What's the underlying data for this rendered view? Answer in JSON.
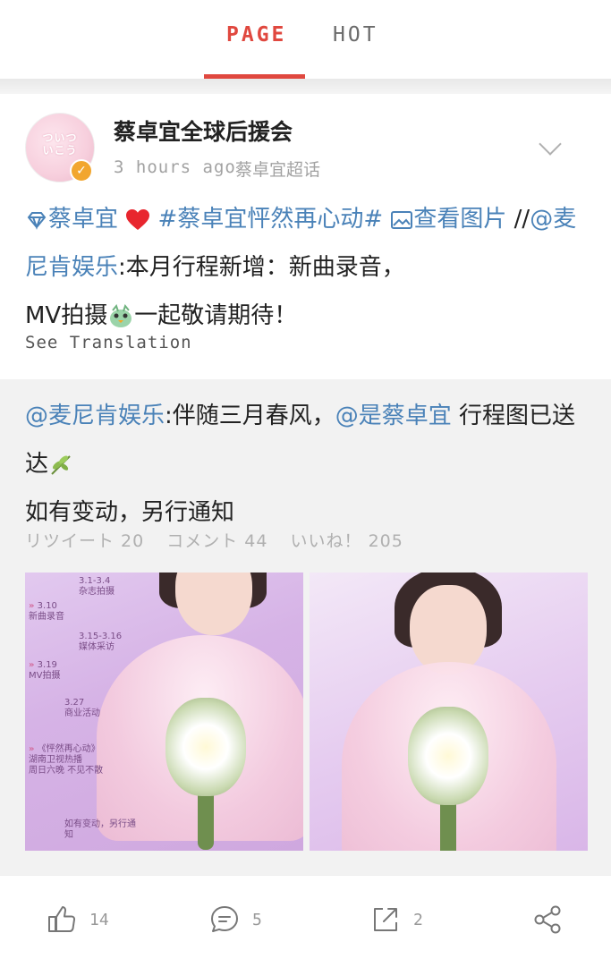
{
  "tabs": {
    "page": "PAGE",
    "hot": "HOT"
  },
  "post": {
    "author": "蔡卓宜全球后援会",
    "avatar_text": "ついつ\nいこう",
    "time": "3 hours ago",
    "source": "蔡卓宜超话",
    "tag1": "蔡卓宜",
    "topic": "#蔡卓宜怦然再心动#",
    "view_image": "查看图片",
    "slashes": "//",
    "mention": "@麦尼肯娱乐",
    "body1": ":本月行程新增：新曲录音，",
    "body2a": "MV拍摄",
    "body2b": "一起敬请期待！",
    "see_translation": "See Translation"
  },
  "repost": {
    "mention1": "@麦尼肯娱乐",
    "text1": ":伴随三月春风，",
    "mention2": "@是蔡卓宜",
    "text2": " 行程图已送达",
    "text3": "如有变动，另行通知",
    "retweets": "リツイート 20",
    "comments": "コメント 44",
    "likes": "いいね！ 205",
    "schedule": [
      {
        "date": "3.1-3.4",
        "desc": "杂志拍摄"
      },
      {
        "date": "3.10",
        "desc": "新曲录音"
      },
      {
        "date": "3.15-3.16",
        "desc": "媒体采访"
      },
      {
        "date": "3.19",
        "desc": "MV拍摄"
      },
      {
        "date": "3.27",
        "desc": "商业活动"
      },
      {
        "date": "《怦然再心动》",
        "desc": "湖南卫视热播"
      },
      {
        "date": "",
        "desc": "周日六晚 不见不散"
      },
      {
        "date": "",
        "desc": "如有变动，另行通知"
      }
    ]
  },
  "actions": {
    "likes": "14",
    "comments": "5",
    "shares": "2"
  },
  "colors": {
    "accent": "#e0483f",
    "link": "#4a82b8",
    "muted": "#a2a2a2"
  }
}
